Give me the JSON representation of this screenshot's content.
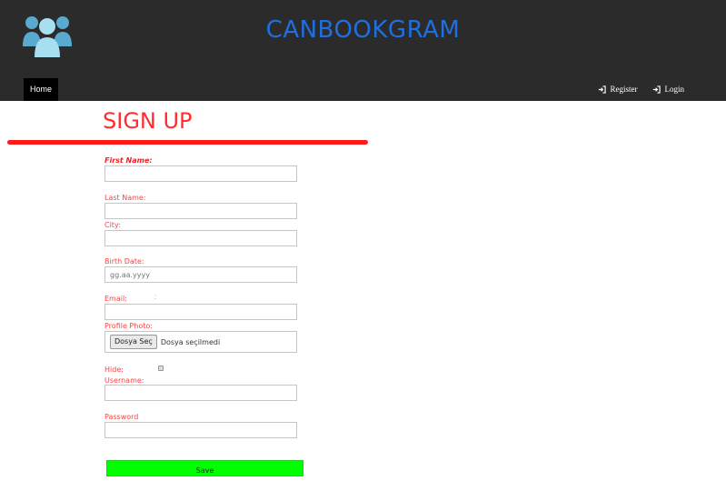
{
  "navbar": {
    "brand": "CANBOOKGRAM",
    "home_label": "Home",
    "register_label": "Register",
    "login_label": "Login",
    "logo_icon": "users-group-icon",
    "colors": {
      "background": "#2b2b2b",
      "brand": "#1f6fe0",
      "logo": "#7fc8e0"
    }
  },
  "form": {
    "title": "SIGN UP",
    "first_name_label": "First Name:",
    "last_name_label": "Last Name:",
    "city_label": "City:",
    "birth_date_label": "Birth Date:",
    "birth_date_placeholder": "gg.aa.yyyy",
    "email_label": "Email:",
    "email_colon": ":",
    "profile_photo_label": "Profile Photo:",
    "file_button_label": "Dosya Seç",
    "file_status": "Dosya seçilmedi",
    "hide_label": "Hide:",
    "username_label": "Username:",
    "password_label": "Password",
    "save_label": "Save",
    "colors": {
      "label": "#ff4040",
      "title": "#ff2d2d",
      "rule": "#ff1a1a",
      "save": "#00ff00"
    }
  }
}
